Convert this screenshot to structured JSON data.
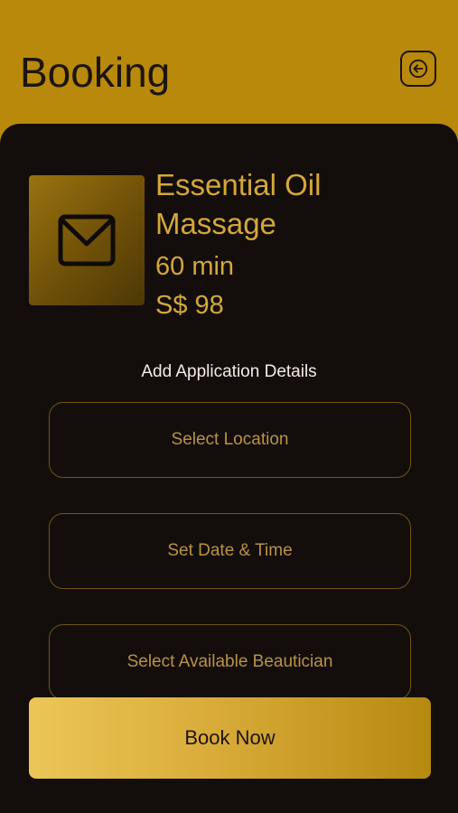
{
  "header": {
    "title": "Booking",
    "back_icon": "arrow-left-icon"
  },
  "service": {
    "image_icon": "envelope-icon",
    "name": "Essential Oil Massage",
    "duration": "60 min",
    "price": "S$ 98"
  },
  "details": {
    "label": "Add Application Details",
    "location_placeholder": "Select Location",
    "datetime_placeholder": "Set Date & Time",
    "beautician_placeholder": "Select Available Beautician"
  },
  "actions": {
    "book_label": "Book Now"
  },
  "colors": {
    "brand_gold": "#b8890a",
    "background_dark": "#130e0c",
    "accent_text": "#d4a73a"
  }
}
